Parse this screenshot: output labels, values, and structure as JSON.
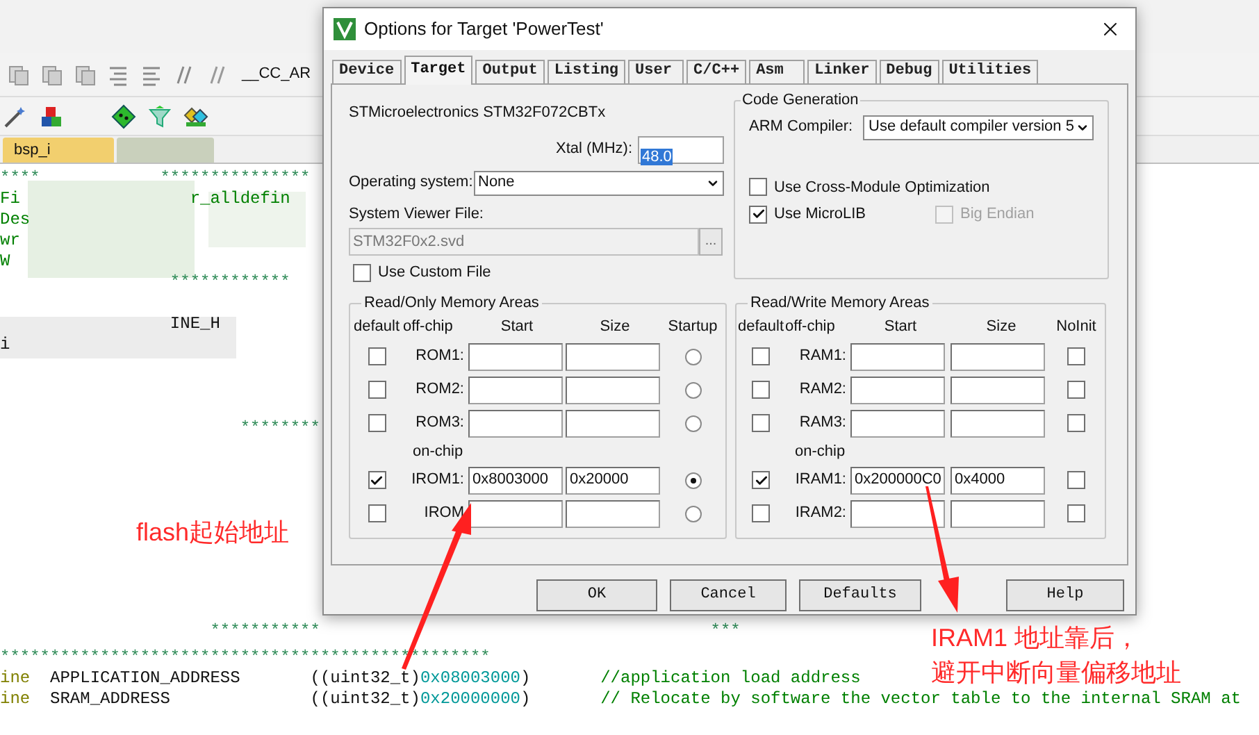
{
  "editor": {
    "toolbar_text": "__CC_AR",
    "file_tab": "bsp_i",
    "lines": [
      {
        "segments": [
          {
            "kind": "stars",
            "text": "****            ***************"
          }
        ]
      },
      {
        "segments": [
          {
            "kind": "comment",
            "text": "Fi                 r_alldefin"
          }
        ]
      },
      {
        "segments": [
          {
            "kind": "comment",
            "text": "Des"
          }
        ]
      },
      {
        "segments": [
          {
            "kind": "comment",
            "text": "wr"
          }
        ]
      },
      {
        "segments": [
          {
            "kind": "comment",
            "text": "W"
          }
        ]
      },
      {
        "segments": [
          {
            "kind": "stars",
            "text": "                 ************"
          }
        ]
      },
      {
        "segments": [
          {
            "kind": "plain",
            "text": "                 INE_H"
          }
        ]
      },
      {
        "segments": [
          {
            "kind": "plain",
            "text": "i"
          }
        ]
      },
      {
        "segments": [
          {
            "kind": "stars",
            "text": "                        ********"
          }
        ]
      },
      {
        "segments": [
          {
            "kind": "stars",
            "text": "                     ***********"
          },
          {
            "kind": "stars",
            "text": "                                       ***"
          }
        ]
      },
      {
        "segments": [
          {
            "kind": "stars",
            "text": "*************************************************"
          }
        ]
      },
      {
        "segments": [
          {
            "kind": "keyword",
            "text": "ine"
          },
          {
            "kind": "plain",
            "text": "  APPLICATION_ADDRESS       ((uint32_t)"
          },
          {
            "kind": "number",
            "text": "0x08003000"
          },
          {
            "kind": "plain",
            "text": ")       "
          },
          {
            "kind": "comment",
            "text": "//application load address"
          }
        ]
      },
      {
        "segments": [
          {
            "kind": "keyword",
            "text": "ine"
          },
          {
            "kind": "plain",
            "text": "  SRAM_ADDRESS              ((uint32_t)"
          },
          {
            "kind": "number",
            "text": "0x20000000"
          },
          {
            "kind": "plain",
            "text": ")       "
          },
          {
            "kind": "comment",
            "text": "// Relocate by software the vector table to the internal SRAM at"
          }
        ]
      }
    ]
  },
  "dialog": {
    "title": "Options for Target 'PowerTest'",
    "tabs": [
      {
        "label": "Device",
        "selected": false
      },
      {
        "label": "Target",
        "selected": true
      },
      {
        "label": "Output",
        "selected": false
      },
      {
        "label": "Listing",
        "selected": false
      },
      {
        "label": "User",
        "selected": false
      },
      {
        "label": "C/C++",
        "selected": false
      },
      {
        "label": "Asm",
        "selected": false
      },
      {
        "label": "Linker",
        "selected": false
      },
      {
        "label": "Debug",
        "selected": false
      },
      {
        "label": "Utilities",
        "selected": false
      }
    ],
    "device": "STMicroelectronics STM32F072CBTx",
    "xtal": {
      "label": "Xtal (MHz):",
      "value": "48.0"
    },
    "os": {
      "label": "Operating system:",
      "value": "None"
    },
    "svd": {
      "label": "System Viewer File:",
      "value": "STM32F0x2.svd",
      "disabled": true,
      "browse": "..."
    },
    "custom_file": {
      "label": "Use Custom File",
      "checked": false
    },
    "code_generation": {
      "title": "Code Generation",
      "compiler_label": "ARM Compiler:",
      "compiler_value": "Use default compiler version 5",
      "options": [
        {
          "label": "Use Cross-Module Optimization",
          "checked": false,
          "disabled": false
        },
        {
          "label": "Use MicroLIB",
          "checked": true,
          "disabled": false
        },
        {
          "label": "Big Endian",
          "checked": false,
          "disabled": true
        }
      ]
    },
    "rom": {
      "title": "Read/Only Memory Areas",
      "headers": [
        "default",
        "off-chip",
        "Start",
        "Size",
        "Startup"
      ],
      "on_chip_label": "on-chip",
      "off_chip": [
        {
          "name": "ROM1:",
          "default": false,
          "selected": false
        },
        {
          "name": "ROM2:",
          "default": false,
          "selected": false
        },
        {
          "name": "ROM3:",
          "default": false,
          "selected": false
        }
      ],
      "on_chip": [
        {
          "name": "IROM1:",
          "default": true,
          "start": "0x8003000",
          "size": "0x20000",
          "selected": true
        },
        {
          "name": "IROM",
          "default": false,
          "selected": false
        }
      ]
    },
    "ram": {
      "title": "Read/Write Memory Areas",
      "headers": [
        "default",
        "off-chip",
        "Start",
        "Size",
        "NoInit"
      ],
      "on_chip_label": "on-chip",
      "off_chip": [
        {
          "name": "RAM1:",
          "default": false,
          "noinit": false
        },
        {
          "name": "RAM2:",
          "default": false,
          "noinit": false
        },
        {
          "name": "RAM3:",
          "default": false,
          "noinit": false
        }
      ],
      "on_chip": [
        {
          "name": "IRAM1:",
          "default": true,
          "start": "0x200000C0",
          "size": "0x4000",
          "noinit": false
        },
        {
          "name": "IRAM2:",
          "default": false,
          "noinit": false
        }
      ]
    },
    "buttons": [
      "OK",
      "Cancel",
      "Defaults",
      "Help"
    ]
  },
  "annotations": [
    {
      "lines": [
        "flash起始地址"
      ]
    },
    {
      "lines": [
        "IRAM1 地址靠后，",
        "避开中断向量偏移地址"
      ]
    }
  ]
}
